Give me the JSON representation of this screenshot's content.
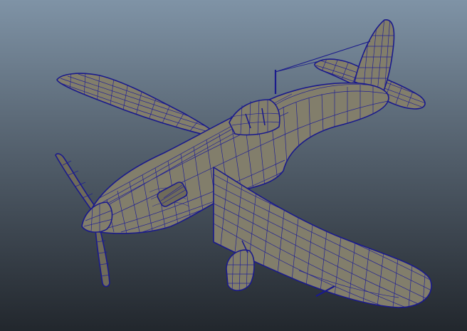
{
  "viewport": {
    "background_top": "#7f93a6",
    "background_bottom": "#22272d",
    "mesh_color": "#827e6b",
    "wireframe_color": "#1a1a8c",
    "display_mode": "wireframe-on-shaded"
  },
  "scene": {
    "object_type": "propeller-fighter-aircraft-mesh"
  }
}
